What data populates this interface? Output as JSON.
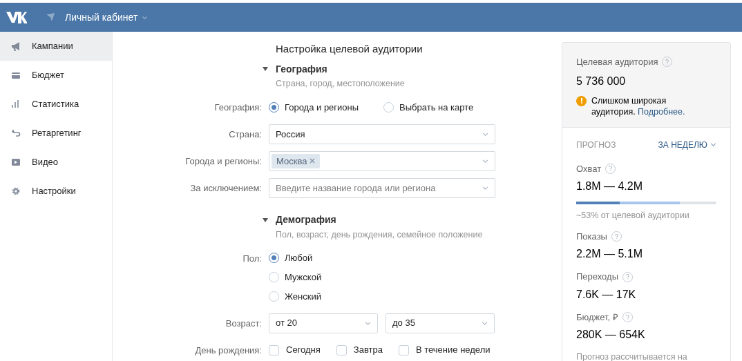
{
  "header": {
    "title": "Личный кабинет"
  },
  "sidebar": {
    "items": [
      {
        "label": "Кампании",
        "selected": true
      },
      {
        "label": "Бюджет",
        "selected": false
      },
      {
        "label": "Статистика",
        "selected": false
      },
      {
        "label": "Ретаргетинг",
        "selected": false
      },
      {
        "label": "Видео",
        "selected": false
      },
      {
        "label": "Настройки",
        "selected": false
      }
    ]
  },
  "form": {
    "title": "Настройка целевой аудитории",
    "sections": [
      {
        "title": "География",
        "subtitle": "Страна, город, местоположение",
        "expanded": true,
        "rows": [
          {
            "kind": "radio-row",
            "label": "География:",
            "options": [
              {
                "label": "Города и регионы",
                "selected": true
              },
              {
                "label": "Выбрать на карте",
                "selected": false
              }
            ]
          },
          {
            "kind": "select",
            "label": "Страна:",
            "value": "Россия"
          },
          {
            "kind": "tags",
            "label": "Города и регионы:",
            "tags": [
              "Москва"
            ]
          },
          {
            "kind": "select",
            "label": "За исключением:",
            "placeholder": "Введите название города или региона"
          }
        ]
      },
      {
        "title": "Демография",
        "subtitle": "Пол, возраст, день рождения, семейное положение",
        "expanded": true,
        "rows": [
          {
            "kind": "radio-list",
            "label": "Пол:",
            "options": [
              {
                "label": "Любой",
                "selected": true
              },
              {
                "label": "Мужской",
                "selected": false
              },
              {
                "label": "Женский",
                "selected": false
              }
            ]
          },
          {
            "kind": "range",
            "label": "Возраст:",
            "from": "от 20",
            "to": "до 35"
          },
          {
            "kind": "checks",
            "label": "День рождения:",
            "options": [
              {
                "label": "Сегодня",
                "checked": false
              },
              {
                "label": "Завтра",
                "checked": false
              },
              {
                "label": "В течение недели",
                "checked": false
              }
            ]
          }
        ]
      }
    ]
  },
  "audience": {
    "label": "Целевая аудитория",
    "value": "5 736 000",
    "warning": "Слишком широкая аудитория.",
    "link": "Подробнее."
  },
  "forecast": {
    "title": "ПРОГНОЗ",
    "period": "ЗА НЕДЕЛЮ",
    "metrics": [
      {
        "label": "Охват",
        "value": "1.8M — 4.2M",
        "bar": [
          {
            "level": 0.31
          },
          {
            "level": 0.74
          }
        ],
        "note": "~53% от целевой аудитории"
      },
      {
        "label": "Показы",
        "value": "2.2M — 5.1M"
      },
      {
        "label": "Переходы",
        "value": "7.6K — 17K"
      },
      {
        "label": "Бюджет, ₽",
        "value": "280K — 654K"
      }
    ],
    "footnote": "Прогноз рассчитывается на"
  }
}
